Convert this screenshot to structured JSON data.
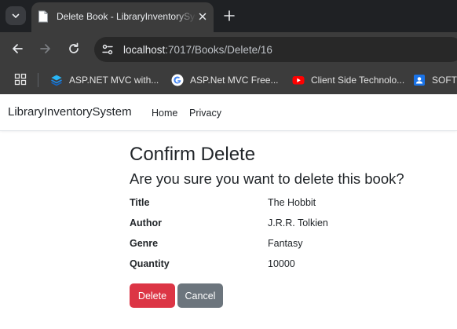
{
  "browser": {
    "tab": {
      "title": "Delete Book - LibraryInventorySystem"
    },
    "url": {
      "host": "localhost",
      "path": ":7017/Books/Delete/16"
    },
    "bookmarks": [
      {
        "label": "ASP.NET MVC with...",
        "icon": "layers-icon",
        "color": "#1e88e5"
      },
      {
        "label": "ASP.Net MVC Free...",
        "icon": "google-icon",
        "color": "#4285f4"
      },
      {
        "label": "Client Side Technolo...",
        "icon": "youtube-icon",
        "color": "#ff0000"
      },
      {
        "label": "SOFTW",
        "icon": "contacts-icon",
        "color": "#1a73e8"
      }
    ]
  },
  "navbar": {
    "brand": "LibraryInventorySystem",
    "links": [
      "Home",
      "Privacy"
    ]
  },
  "page": {
    "heading": "Confirm Delete",
    "question": "Are you sure you want to delete this book?",
    "details": [
      {
        "label": "Title",
        "value": "The Hobbit"
      },
      {
        "label": "Author",
        "value": "J.R.R. Tolkien"
      },
      {
        "label": "Genre",
        "value": "Fantasy"
      },
      {
        "label": "Quantity",
        "value": "10000"
      }
    ],
    "delete_label": "Delete",
    "cancel_label": "Cancel"
  },
  "colors": {
    "danger": "#dc3545",
    "secondary": "#6c757d",
    "chrome_dark": "#1f2124",
    "chrome_toolbar": "#3c3c3c"
  }
}
